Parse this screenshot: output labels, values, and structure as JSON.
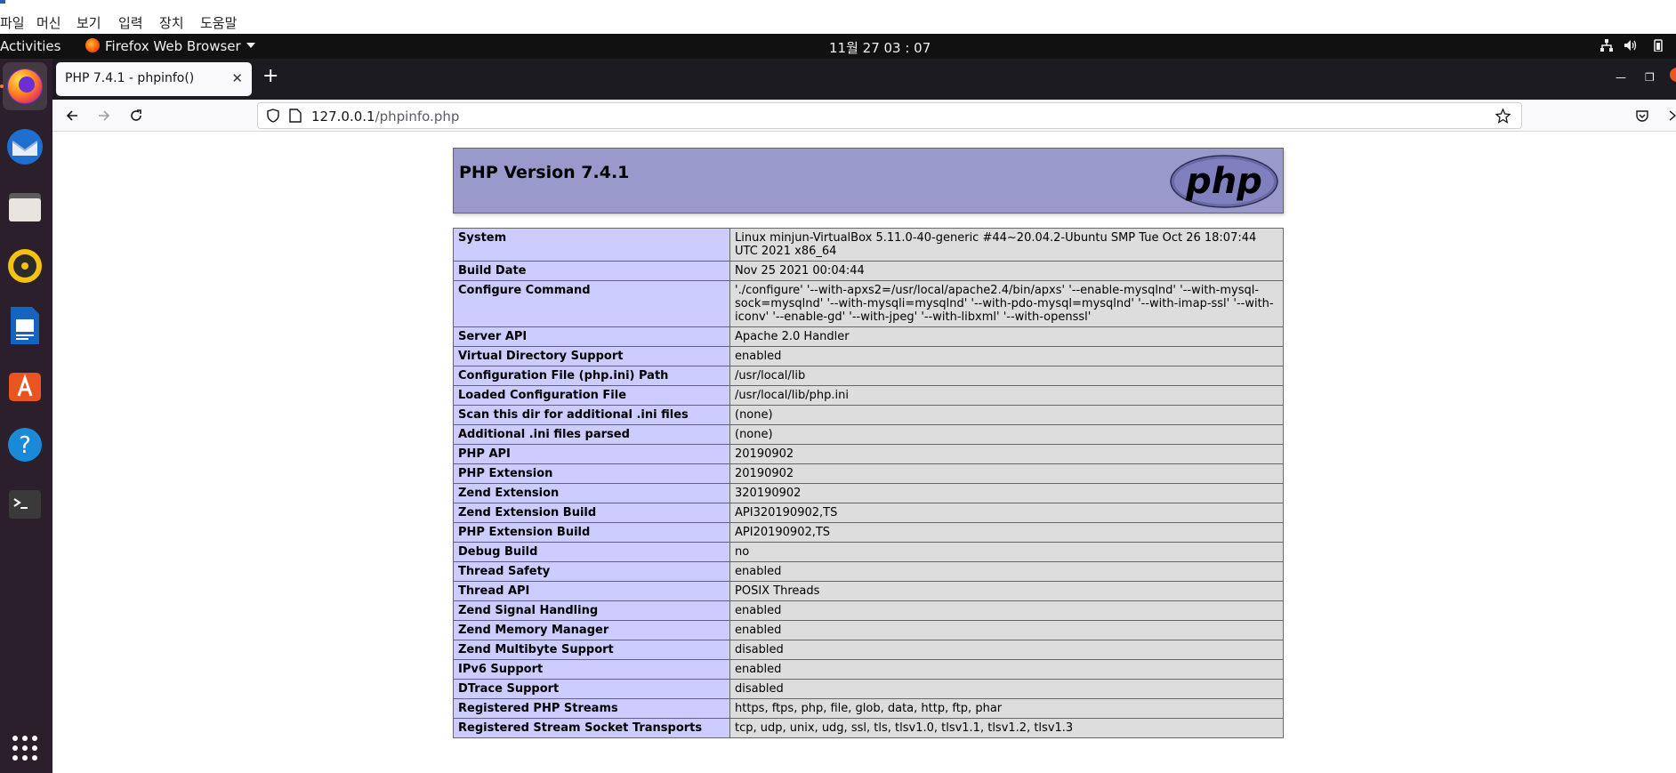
{
  "vbox_menu": {
    "items": [
      "파일",
      "머신",
      "보기",
      "입력",
      "장치",
      "도움말"
    ]
  },
  "topbar": {
    "activities": "Activities",
    "app_name": "Firefox Web Browser",
    "clock": "11월 27  03 : 07"
  },
  "dock": {
    "apps": [
      "firefox-icon",
      "thunderbird-icon",
      "files-icon",
      "rhythmbox-icon",
      "writer-icon",
      "app-center-icon",
      "help-icon",
      "terminal-icon"
    ]
  },
  "browser": {
    "tab_title": "PHP 7.4.1 - phpinfo()",
    "url_host": "127.0.0.1",
    "url_path": "/phpinfo.php"
  },
  "colors": {
    "header_bg": "#9999cc",
    "key_cell_bg": "#ccccff",
    "value_cell_bg": "#dddddd",
    "dock_bg": "#2b1f2b",
    "topbar_bg": "#111111"
  },
  "phpinfo": {
    "title": "PHP Version 7.4.1",
    "logo_text": "php",
    "rows": [
      {
        "key": "System",
        "value": "Linux minjun-VirtualBox 5.11.0-40-generic #44~20.04.2-Ubuntu SMP Tue Oct 26 18:07:44 UTC 2021 x86_64"
      },
      {
        "key": "Build Date",
        "value": "Nov 25 2021 00:04:44"
      },
      {
        "key": "Configure Command",
        "value": "'./configure' '--with-apxs2=/usr/local/apache2.4/bin/apxs' '--enable-mysqlnd' '--with-mysql-sock=mysqlnd' '--with-mysqli=mysqlnd' '--with-pdo-mysql=mysqlnd' '--with-imap-ssl' '--with-iconv' '--enable-gd' '--with-jpeg' '--with-libxml' '--with-openssl'"
      },
      {
        "key": "Server API",
        "value": "Apache 2.0 Handler"
      },
      {
        "key": "Virtual Directory Support",
        "value": "enabled"
      },
      {
        "key": "Configuration File (php.ini) Path",
        "value": "/usr/local/lib"
      },
      {
        "key": "Loaded Configuration File",
        "value": "/usr/local/lib/php.ini"
      },
      {
        "key": "Scan this dir for additional .ini files",
        "value": "(none)"
      },
      {
        "key": "Additional .ini files parsed",
        "value": "(none)"
      },
      {
        "key": "PHP API",
        "value": "20190902"
      },
      {
        "key": "PHP Extension",
        "value": "20190902"
      },
      {
        "key": "Zend Extension",
        "value": "320190902"
      },
      {
        "key": "Zend Extension Build",
        "value": "API320190902,TS"
      },
      {
        "key": "PHP Extension Build",
        "value": "API20190902,TS"
      },
      {
        "key": "Debug Build",
        "value": "no"
      },
      {
        "key": "Thread Safety",
        "value": "enabled"
      },
      {
        "key": "Thread API",
        "value": "POSIX Threads"
      },
      {
        "key": "Zend Signal Handling",
        "value": "enabled"
      },
      {
        "key": "Zend Memory Manager",
        "value": "enabled"
      },
      {
        "key": "Zend Multibyte Support",
        "value": "disabled"
      },
      {
        "key": "IPv6 Support",
        "value": "enabled"
      },
      {
        "key": "DTrace Support",
        "value": "disabled"
      },
      {
        "key": "Registered PHP Streams",
        "value": "https, ftps, php, file, glob, data, http, ftp, phar"
      },
      {
        "key": "Registered Stream Socket Transports",
        "value": "tcp, udp, unix, udg, ssl, tls, tlsv1.0, tlsv1.1, tlsv1.2, tlsv1.3"
      }
    ]
  }
}
